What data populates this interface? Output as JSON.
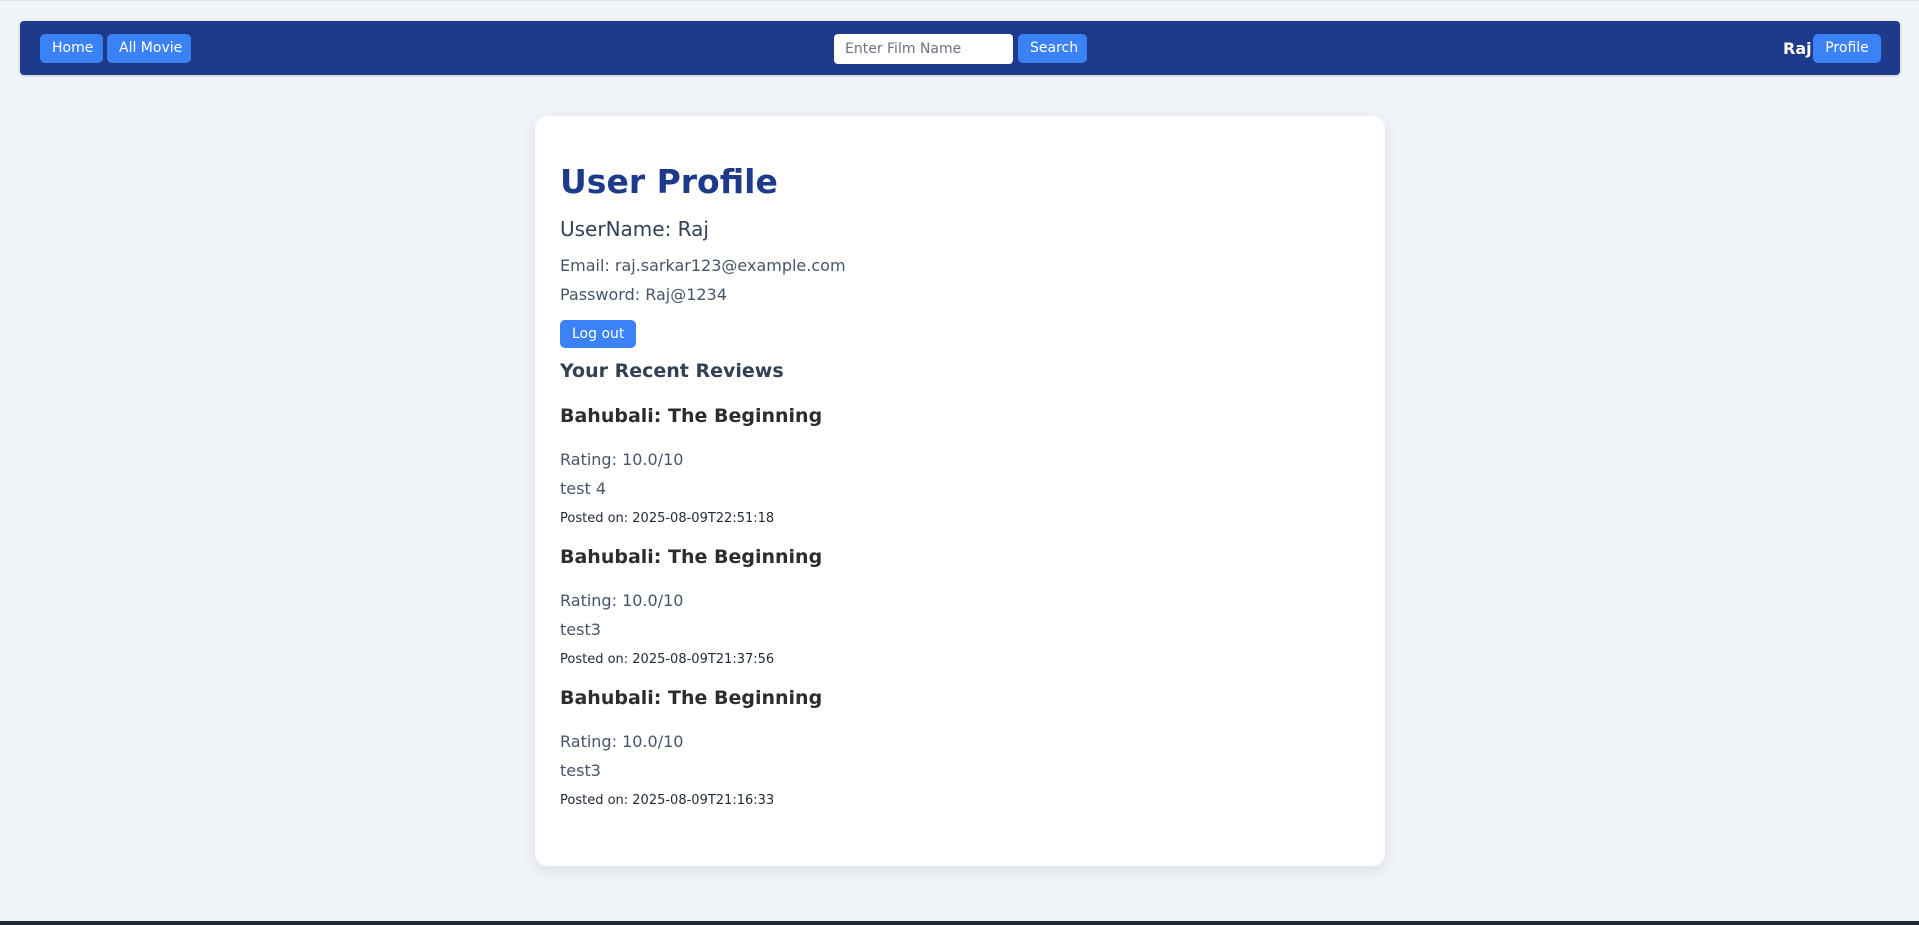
{
  "nav": {
    "home_label": "Home",
    "allmovie_label": "All Movie",
    "search_placeholder": "Enter Film Name",
    "search_value": "",
    "search_label": "Search",
    "username": "Raj",
    "profile_label": "Profile"
  },
  "profile": {
    "title": "User Profile",
    "username_line": "UserName: Raj",
    "email_line": "Email: raj.sarkar123@example.com",
    "password_line": "Password: Raj@1234",
    "logout_label": "Log out",
    "reviews_heading": "Your Recent Reviews",
    "reviews": [
      {
        "title": "Bahubali: The Beginning",
        "rating": "Rating: 10.0/10",
        "text": "test 4",
        "posted": "Posted on: 2025-08-09T22:51:18"
      },
      {
        "title": "Bahubali: The Beginning",
        "rating": "Rating: 10.0/10",
        "text": "test3",
        "posted": "Posted on: 2025-08-09T21:37:56"
      },
      {
        "title": "Bahubali: The Beginning",
        "rating": "Rating: 10.0/10",
        "text": "test3",
        "posted": "Posted on: 2025-08-09T21:16:33"
      }
    ]
  },
  "colors": {
    "navbar": "#1e3a8a",
    "button": "#3b82f6",
    "page_background": "#f1f5f9",
    "title": "#1e3a8a"
  }
}
